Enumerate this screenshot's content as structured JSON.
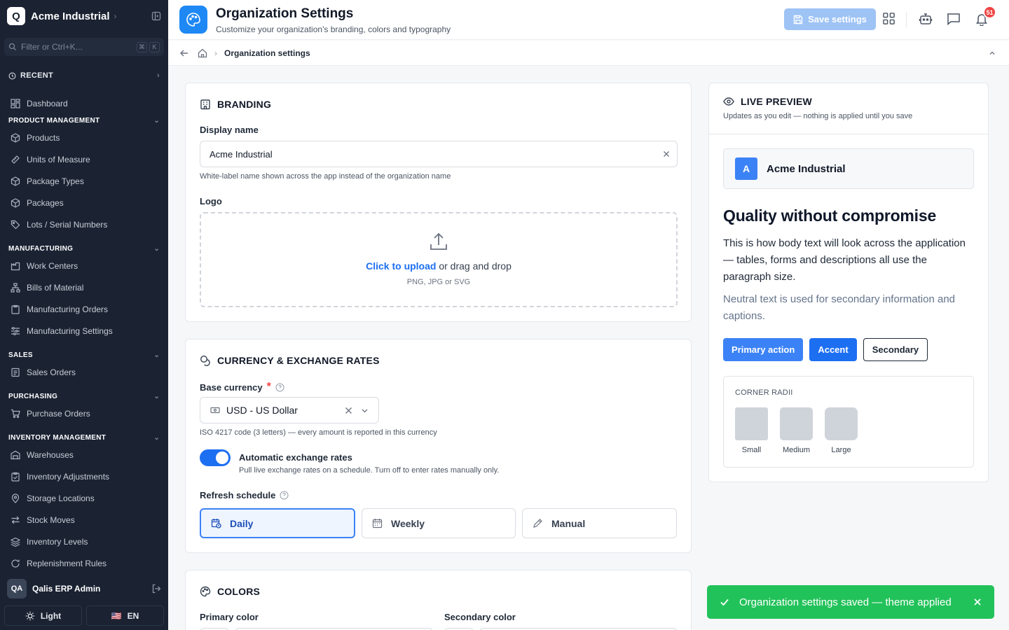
{
  "sidebar": {
    "logo_letter": "Q",
    "org_name": "Acme Industrial",
    "filter_placeholder": "Filter or Ctrl+K...",
    "filter_keys": [
      "⌘",
      "K"
    ],
    "recent_label": "RECENT",
    "dashboard": "Dashboard",
    "sections": {
      "product_management": "PRODUCT MANAGEMENT",
      "manufacturing": "MANUFACTURING",
      "sales": "SALES",
      "purchasing": "PURCHASING",
      "inventory_management": "INVENTORY MANAGEMENT"
    },
    "product_items": [
      "Products",
      "Units of Measure",
      "Package Types",
      "Packages",
      "Lots / Serial Numbers"
    ],
    "manufacturing_items": [
      "Work Centers",
      "Bills of Material",
      "Manufacturing Orders",
      "Manufacturing Settings"
    ],
    "sales_items": [
      "Sales Orders"
    ],
    "purchasing_items": [
      "Purchase Orders"
    ],
    "inventory_items": [
      "Warehouses",
      "Inventory Adjustments",
      "Storage Locations",
      "Stock Moves",
      "Inventory Levels",
      "Replenishment Rules"
    ],
    "user_initials": "QA",
    "user_name": "Qalis ERP Admin",
    "theme_label": "Light",
    "lang_flag": "🇺🇸",
    "lang_label": "EN"
  },
  "header": {
    "title": "Organization Settings",
    "subtitle": "Customize your organization's branding, colors and typography",
    "save_label": "Save settings",
    "notification_count": "51"
  },
  "breadcrumb": {
    "current": "Organization settings"
  },
  "branding": {
    "title": "BRANDING",
    "display_name_label": "Display name",
    "display_name_value": "Acme Industrial",
    "display_name_help": "White-label name shown across the app instead of the organization name",
    "logo_label": "Logo",
    "upload_link": "Click to upload",
    "upload_rest": "or drag and drop",
    "upload_formats": "PNG, JPG or SVG"
  },
  "currency": {
    "title": "CURRENCY & EXCHANGE RATES",
    "base_label": "Base currency",
    "required_mark": "*",
    "base_value": "USD - US Dollar",
    "base_help": "ISO 4217 code (3 letters) — every amount is reported in this currency",
    "auto_label": "Automatic exchange rates",
    "auto_desc": "Pull live exchange rates on a schedule. Turn off to enter rates manually only.",
    "auto_on": true,
    "schedule_label": "Refresh schedule",
    "schedule_options": [
      "Daily",
      "Weekly",
      "Manual"
    ],
    "schedule_selected": "Daily"
  },
  "colors": {
    "title": "COLORS",
    "primary_label": "Primary color",
    "secondary_label": "Secondary color"
  },
  "preview": {
    "title": "LIVE PREVIEW",
    "subtitle": "Updates as you edit — nothing is applied until you save",
    "brand_letter": "A",
    "brand_name": "Acme Industrial",
    "heading": "Quality without compromise",
    "body_text": "This is how body text will look across the application — tables, forms and descriptions all use the paragraph size.",
    "neutral_text": "Neutral text is used for secondary information and captions.",
    "btn_primary": "Primary action",
    "btn_accent": "Accent",
    "btn_secondary": "Secondary",
    "radii_title": "CORNER RADII",
    "radii": [
      {
        "label": "Small",
        "radius": "sm"
      },
      {
        "label": "Medium",
        "radius": "md"
      },
      {
        "label": "Large",
        "radius": "lg"
      }
    ]
  },
  "toast": {
    "message": "Organization settings saved — theme applied"
  },
  "theme": {
    "primary": "#3b82f6",
    "accent": "#1d6ff2",
    "sidebar_bg": "#1b2333",
    "success": "#22c25a"
  }
}
